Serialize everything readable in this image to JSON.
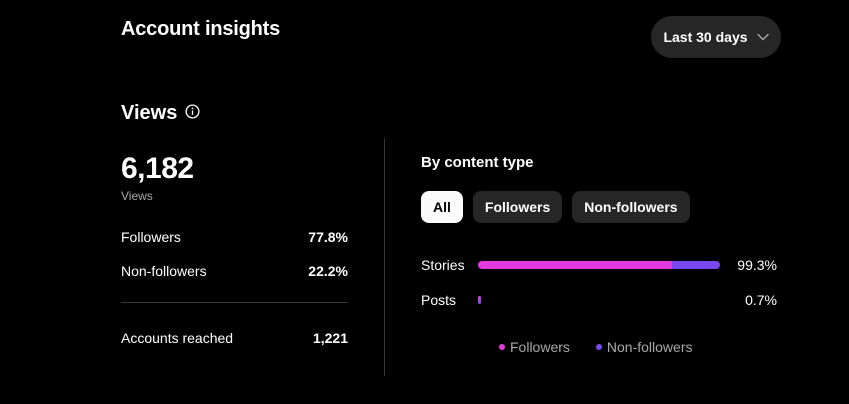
{
  "header": {
    "title": "Account insights",
    "range_label": "Last 30 days"
  },
  "views": {
    "title": "Views",
    "total": "6,182",
    "total_label": "Views",
    "followers_label": "Followers",
    "followers_value": "77.8%",
    "nonfollowers_label": "Non-followers",
    "nonfollowers_value": "22.2%",
    "reached_label": "Accounts reached",
    "reached_value": "1,221"
  },
  "content_type": {
    "title": "By content type",
    "filters": [
      {
        "label": "All",
        "selected": true
      },
      {
        "label": "Followers",
        "selected": false
      },
      {
        "label": "Non-followers",
        "selected": false
      }
    ],
    "rows": [
      {
        "label": "Stories",
        "value": "99.3%",
        "share": 0.993,
        "followers_fraction": 0.8
      },
      {
        "label": "Posts",
        "value": "0.7%",
        "share": 0.007,
        "followers_fraction": 0.5
      }
    ],
    "legend": [
      {
        "label": "Followers",
        "color": "#e33ae0"
      },
      {
        "label": "Non-followers",
        "color": "#7a48f0"
      }
    ]
  },
  "colors": {
    "background": "#000000",
    "chip_bg": "#262626",
    "chip_active_bg": "#fafafa",
    "followers": "#e33ae0",
    "nonfollowers": "#7a48f0"
  }
}
